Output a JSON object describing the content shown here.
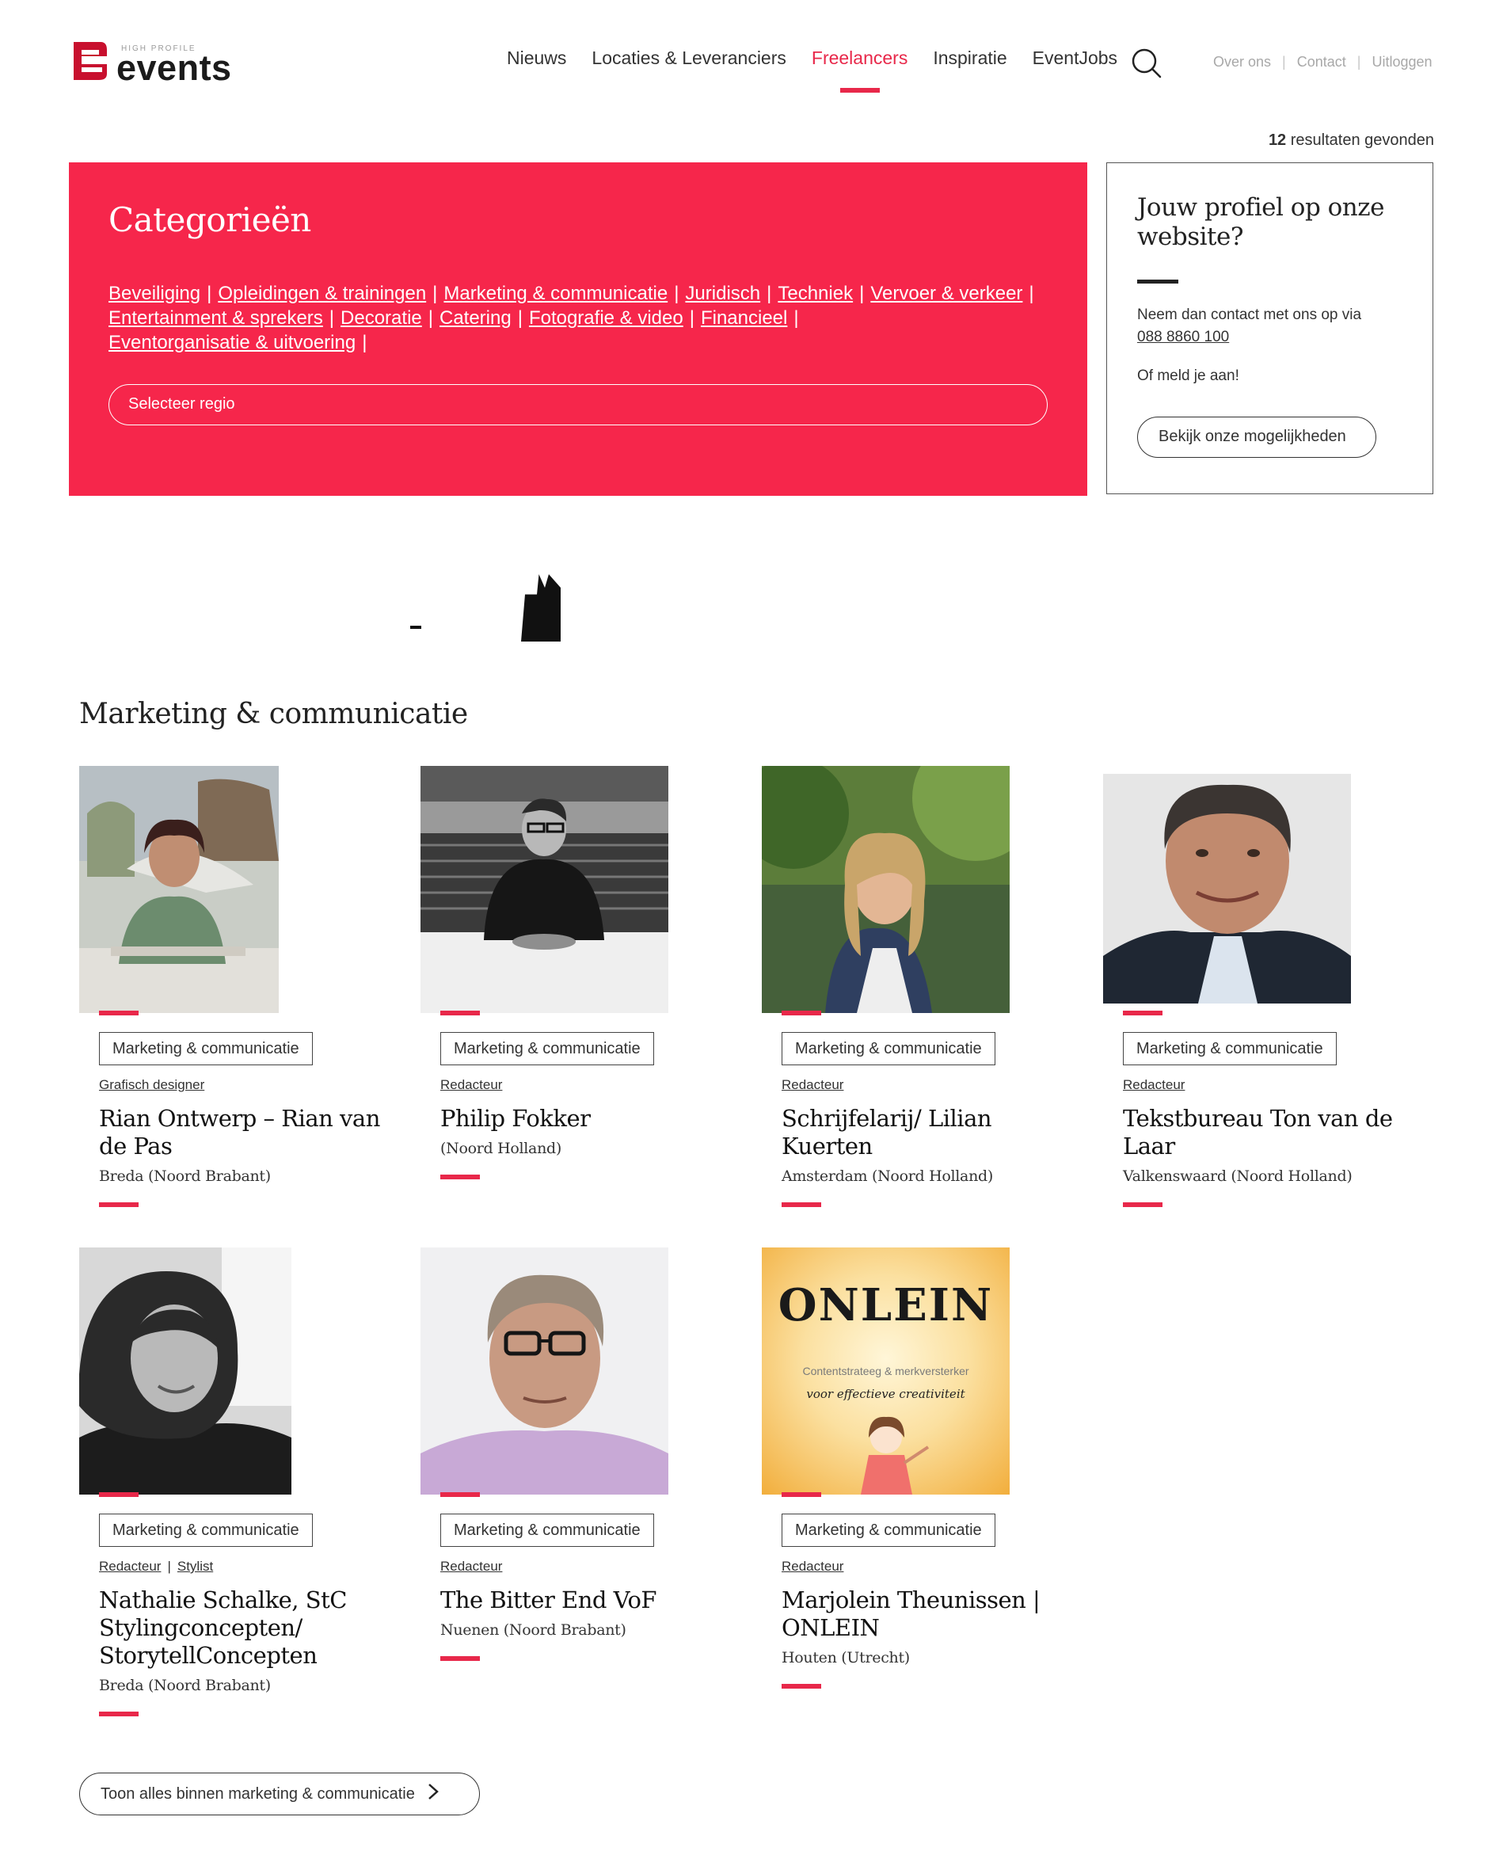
{
  "header": {
    "logo_small": "HIGH PROFILE",
    "logo_big": "events",
    "nav": [
      "Nieuws",
      "Locaties & Leveranciers",
      "Freelancers",
      "Inspiratie",
      "EventJobs"
    ],
    "active_nav": "Freelancers",
    "util_nav": [
      "Over ons",
      "Contact",
      "Uitloggen"
    ]
  },
  "results": {
    "count": "12",
    "label": "resultaten gevonden"
  },
  "categories": {
    "title": "Categorieën",
    "links": [
      "Beveiliging",
      "Opleidingen & trainingen",
      "Marketing & communicatie",
      "Juridisch",
      "Techniek",
      "Vervoer & verkeer",
      "Entertainment & sprekers",
      "Decoratie",
      "Catering",
      "Fotografie & video",
      "Financieel",
      "Eventorganisatie & uitvoering"
    ],
    "separator": "|",
    "region_placeholder": "Selecteer regio"
  },
  "profile_box": {
    "title": "Jouw profiel op onze website?",
    "text": "Neem dan contact met ons op via",
    "phone": "088 8860 100",
    "text2": "Of meld je aan!",
    "button": "Bekijk onze mogelijkheden"
  },
  "section": {
    "title": "Marketing & communicatie",
    "cards": [
      {
        "tag": "Marketing & communicatie",
        "roles": [
          "Grafisch designer"
        ],
        "name": "Rian Ontwerp – Rian van de Pas",
        "location": "Breda (Noord Brabant)"
      },
      {
        "tag": "Marketing & communicatie",
        "roles": [
          "Redacteur"
        ],
        "name": "Philip Fokker",
        "location": "(Noord Holland)"
      },
      {
        "tag": "Marketing & communicatie",
        "roles": [
          "Redacteur"
        ],
        "name": "Schrijfelarij/ Lilian Kuerten",
        "location": "Amsterdam (Noord Holland)"
      },
      {
        "tag": "Marketing & communicatie",
        "roles": [
          "Redacteur"
        ],
        "name": "Tekstbureau Ton van de Laar",
        "location": "Valkenswaard (Noord Holland)"
      },
      {
        "tag": "Marketing & communicatie",
        "roles": [
          "Redacteur",
          "Stylist"
        ],
        "name": "Nathalie Schalke, StC Stylingconcepten/ StorytellConcepten",
        "location": "Breda (Noord Brabant)"
      },
      {
        "tag": "Marketing & communicatie",
        "roles": [
          "Redacteur"
        ],
        "name": "The Bitter End VoF",
        "location": "Nuenen (Noord Brabant)"
      },
      {
        "tag": "Marketing & communicatie",
        "roles": [
          "Redacteur"
        ],
        "name": "Marjolein Theunissen | ONLEIN",
        "location": "Houten (Utrecht)"
      }
    ],
    "onlein_logo": {
      "brand": "ONLEIN",
      "line1": "Contentstrateeg & merkversterker",
      "line2": "voor effectieve creativiteit"
    },
    "show_all": "Toon alles binnen marketing & communicatie"
  },
  "colors": {
    "accent": "#e8284a",
    "panel": "#f6264b",
    "text": "#222222"
  }
}
